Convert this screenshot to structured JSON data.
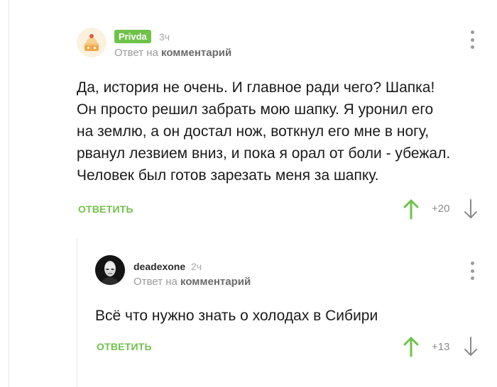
{
  "comments": [
    {
      "badge": "Privda",
      "time": "3ч",
      "reply_prefix": "Ответ на",
      "reply_target": "комментарий",
      "text_lines": [
        "Да, история не очень. И главное ради чего? Шапка!",
        "Он просто решил забрать мою шапку. Я уронил его",
        "на землю, а он достал нож, воткнул его мне в ногу,",
        "рванул лезвием вниз, и пока я орал от боли - убежал.",
        "Человек был готов зарезать меня за шапку."
      ],
      "reply_label": "ОТВЕТИТЬ",
      "rating": "+20"
    },
    {
      "username": "deadexone",
      "time": "2ч",
      "reply_prefix": "Ответ на",
      "reply_target": "комментарий",
      "text": "Всё что нужно знать о холодах в Сибири",
      "reply_label": "ОТВЕТИТЬ",
      "rating": "+13"
    }
  ],
  "colors": {
    "accent": "#6fc24a",
    "muted": "#9a9a9a",
    "text": "#1a1a1a"
  },
  "icons": [
    "avatar-cake",
    "avatar-bald-man",
    "kebab-menu-icon",
    "upvote-arrow-icon",
    "downvote-arrow-icon"
  ]
}
